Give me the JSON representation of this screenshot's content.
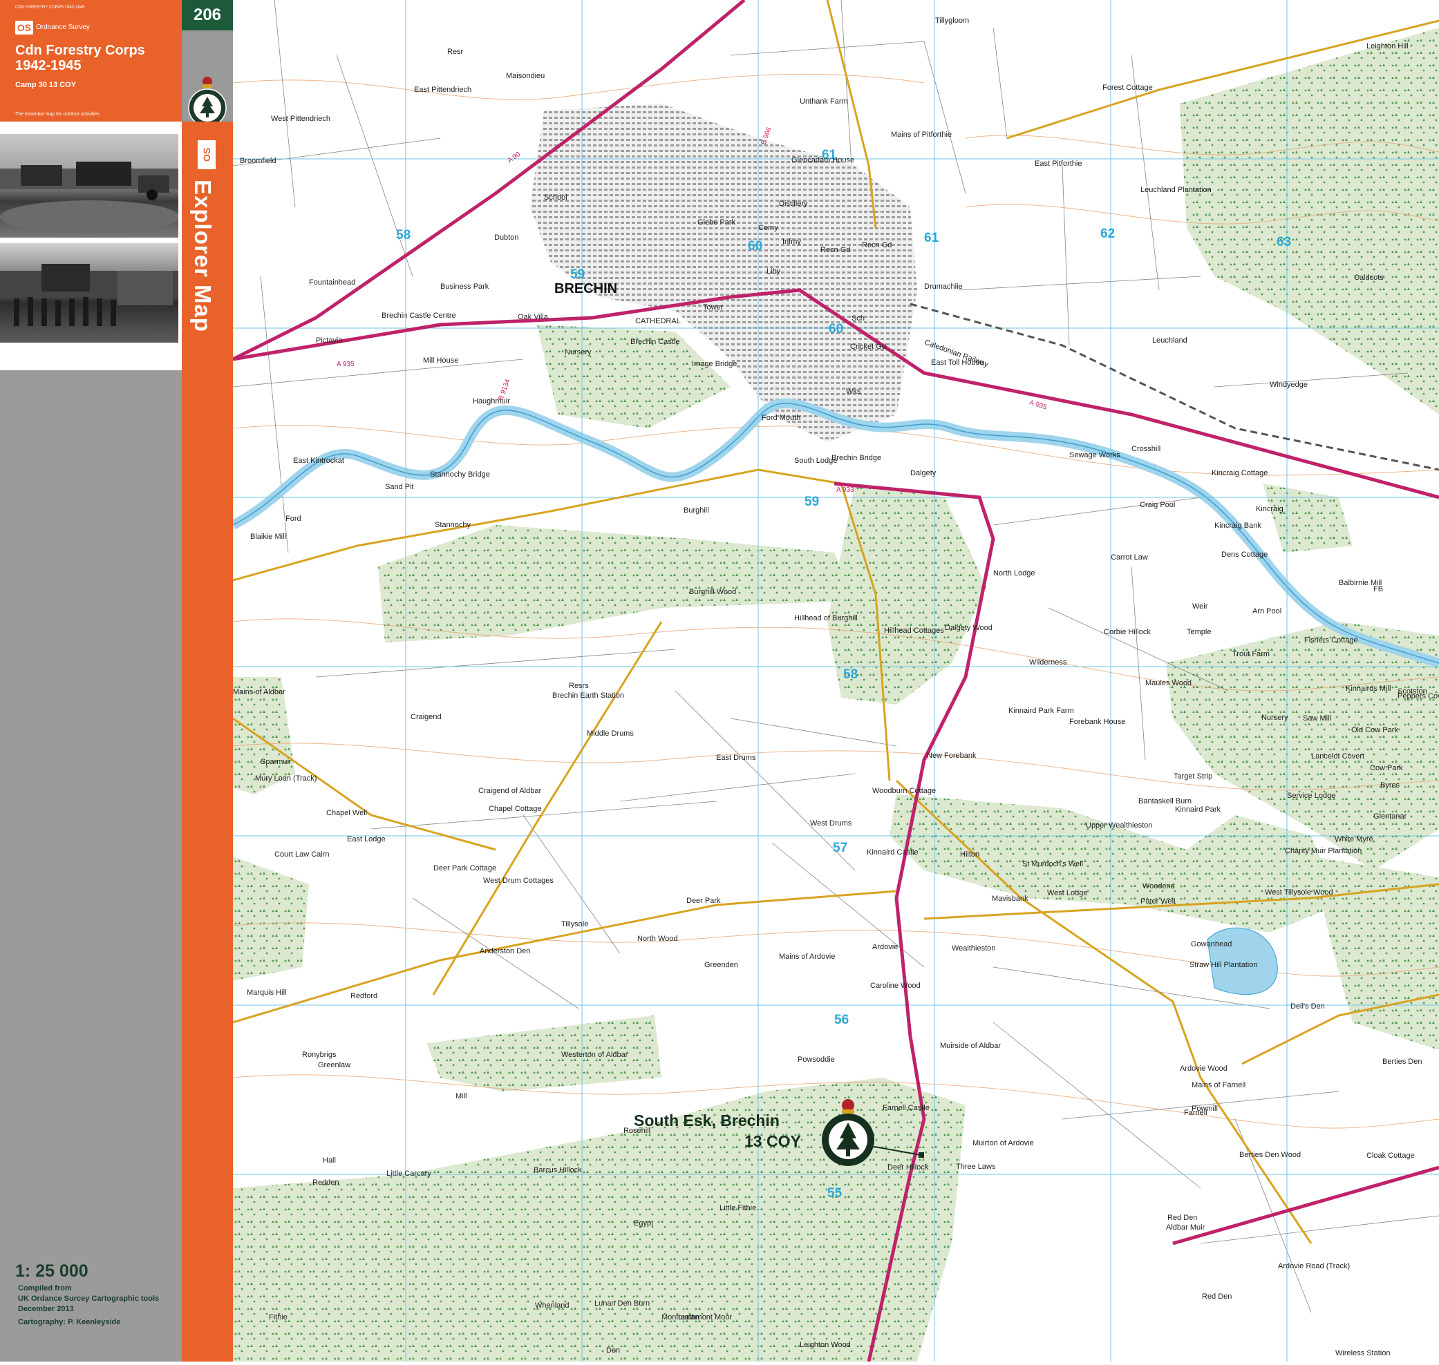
{
  "cover": {
    "tiny_title": "CDN FORESTRY CORPS 1942-1945",
    "os_mark": "OS",
    "os_name": "Ordnance Survey",
    "title": "Cdn Forestry Corps\n1942-1945",
    "subtitle": "Camp 30 13 COY",
    "tagline": "The essential map for outdoor activities",
    "sheet_number": "206",
    "spine_title": "Explorer Map"
  },
  "footer": {
    "scale": "1: 25 000",
    "compiled_lines": [
      "Compiled from",
      "UK Ordance Surcey Cartographic tools",
      "December 2013"
    ],
    "cartography": "Cartography: P. Keenleyside"
  },
  "colors": {
    "cover_orange": "#e8622a",
    "sheet_green": "#1d5a3a",
    "panel_grey": "#9b9b9b",
    "road_a": "#c0226a",
    "road_b": "#d8a320",
    "woodland": "#dde8d0",
    "water": "#9fd4ec",
    "grid": "#6fc6ea",
    "contour": "#e7a26c",
    "camp_label": "#15301f"
  },
  "map": {
    "town_label": "BRECHIN",
    "camp_label_1": "South Esk, Brechin",
    "camp_label_2": "13 COY",
    "grid_labels": [
      "58",
      "59",
      "60",
      "61",
      "62",
      "63",
      "61",
      "60",
      "59",
      "58",
      "57",
      "56",
      "55"
    ],
    "road_labels": [
      "A 90",
      "A 935",
      "A 935",
      "A 933",
      "B 966",
      "B 9134"
    ],
    "rail_label": "Caledonian Railway",
    "places": [
      "Tillygloom",
      "Resr",
      "Maisondieu",
      "East Pittendriech",
      "West Pittendriech",
      "Unthank Farm",
      "Mains of Pitforthie",
      "Forest Cottage",
      "East Pitforthie",
      "Leuchland Plantation",
      "Leighton Hill",
      "Broomfield",
      "School",
      "Glencadam House",
      "Distillery",
      "Glebe Park",
      "Cemy",
      "Infmy",
      "Recn Gd",
      "Recn Gd",
      "Dubton",
      "Business Park",
      "Fountainhead",
      "Brechin Castle Centre",
      "Oak Villa",
      "CATHEDRAL",
      "Tower",
      "Liby",
      "Drumachlie",
      "Caldcots",
      "Pictavia",
      "Mill House",
      "Nursery",
      "Brechin Castle",
      "Image Bridge",
      "Sch",
      "Cricket Gd",
      "East Toll House",
      "Leuchland",
      "Windyedge",
      "Haughmuir",
      "Wks",
      "Ford Mouth",
      "East Kintrockat",
      "Sand Pit",
      "Stannochy Bridge",
      "Stannochy",
      "Ford",
      "Burghill",
      "South Lodge",
      "Brechin Bridge",
      "Dalgety",
      "Sewage Works",
      "Crosshill",
      "Kincraig Cottage",
      "Kincraig",
      "Kincraig Bank",
      "Dens Cottage",
      "Craig Pool",
      "Carrot Law",
      "North Lodge",
      "Blaikie Mill",
      "Burghill Wood",
      "Balbirnie Mill",
      "FB",
      "Weir",
      "Temple",
      "Arn Pool",
      "Hillhead of Burghill",
      "Hillhead Cottages",
      "Dalgety Wood",
      "Corbie Hillock",
      "Wilderness",
      "Trout Farm",
      "Fishers Cottage",
      "Mains of Aldbar",
      "Resrs",
      "Brechin Earth Station",
      "Maules Wood",
      "Kinnairds Mill",
      "Scotston",
      "Peppers Covert",
      "Craigend",
      "Middle Drums",
      "Kinnaird Park Farm",
      "Forebank House",
      "Nursery",
      "Saw Mill",
      "Old Cow Park",
      "East Drums",
      "New Forebank",
      "Lancelot Covert",
      "Cow Park",
      "Sparmuir",
      "Target Strip",
      "Byres",
      "Mury Loan (Track)",
      "Craigend of Aldbar",
      "Woodburn Cottage",
      "Bantaskell Burn",
      "Service Lodge",
      "Kinnaird Park",
      "Chapel Well",
      "Chapel Cottage",
      "West Drums",
      "Upper Wealthieston",
      "Glentanar",
      "East Lodge",
      "Court Law Cairn",
      "White Myre",
      "Kinnaird Castle",
      "Hilton",
      "Charity Muir Plantation",
      "Deer Park Cottage",
      "West Drum Cottages",
      "St Murdoch's Well",
      "West Lodge",
      "West Tillysole Wood",
      "Deer Park",
      "Mavisbank",
      "Woodend",
      "Pater Well",
      "Tillysole",
      "North Wood",
      "Ardovie",
      "Wealthieston",
      "Gowanhead",
      "Anderston Den",
      "Mains of Ardovie",
      "Greenden",
      "Straw Hill Plantation",
      "Caroline Wood",
      "Deil's Den",
      "Redford",
      "Marquis Hill",
      "Muirside of Aldbar",
      "Ronybrigs",
      "Greenlaw",
      "Westerton of Aldbar",
      "Powsoddie",
      "Ardovie Wood",
      "Berties Den",
      "Mains of Farnell",
      "Powmill",
      "Farnell",
      "Farnell Castle",
      "Mill",
      "Rosehill",
      "Muirton of Ardovie",
      "Berties Den Wood",
      "Cloak Cottage",
      "Hall",
      "Little Carcary",
      "Barcus Hillock",
      "Deer Hillock",
      "Three Laws",
      "Redden",
      "Red Den",
      "Aldbar Muir",
      "Egypt",
      "Little Fithie",
      "Ardovie Road (Track)",
      "Red Den",
      "Fithie",
      "Whenland",
      "Lunan Den Burn",
      "Montreathmont Moor",
      "Lunan",
      "Den",
      "Wireless Station",
      "Leighton Wood"
    ]
  }
}
